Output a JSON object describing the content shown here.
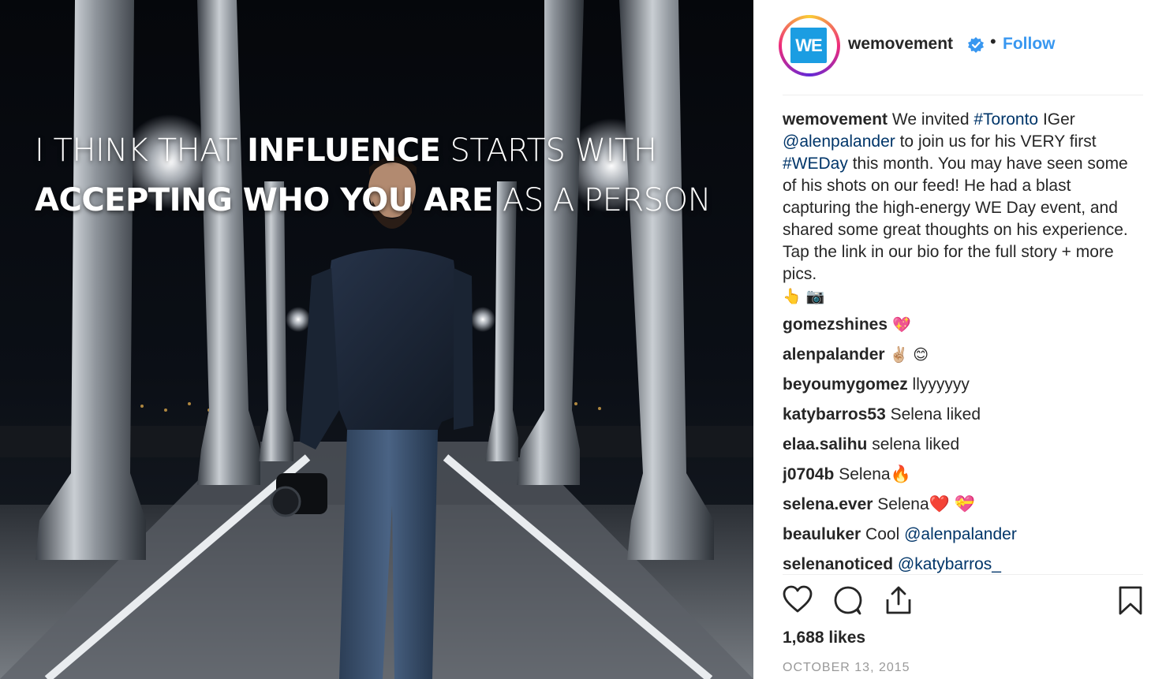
{
  "post": {
    "quote": {
      "line1_light_a": "I THINK THAT ",
      "line1_bold": "INFLUENCE",
      "line1_light_b": " STARTS WITH",
      "line2_bold": "ACCEPTING WHO YOU ARE",
      "line2_light": " AS A PERSON"
    }
  },
  "header": {
    "avatar_text": "WE",
    "username": "wemovement",
    "dot": "•",
    "follow_label": "Follow"
  },
  "caption": {
    "username": "wemovement",
    "t1": " We invited ",
    "tag_toronto": "#Toronto",
    "t2": " IGer ",
    "mention": "@alenpalander",
    "t3": " to join us for his VERY first ",
    "tag_weday": "#WEDay",
    "t4": " this month. You may have seen some of his shots on our feed! He had a blast capturing the high-energy WE Day event, and shared some great thoughts on his experience. Tap the link in our bio for the full story + more pics.",
    "emojis": "👆 📷"
  },
  "comments": [
    {
      "user": "gomezshines",
      "text": " 💖"
    },
    {
      "user": "alenpalander",
      "text": " ✌🏼 😊"
    },
    {
      "user": "beyoumygomez",
      "text": " llyyyyyy"
    },
    {
      "user": "katybarros53",
      "text": " Selena liked"
    },
    {
      "user": "elaa.salihu",
      "text": " selena liked"
    },
    {
      "user": "j0704b",
      "text": " Selena🔥"
    },
    {
      "user": "selena.ever",
      "text": " Selena❤️ 💝"
    },
    {
      "user": "beauluker",
      "text": " Cool ",
      "mention": "@alenpalander"
    },
    {
      "user": "selenanoticed",
      "text": " ",
      "mention": "@katybarros_"
    }
  ],
  "actions": {
    "icons": [
      "heart-icon",
      "comment-icon",
      "share-icon",
      "bookmark-icon"
    ]
  },
  "likes": "1,688 likes",
  "date": "OCTOBER 13, 2015",
  "colors": {
    "link": "#003569",
    "follow": "#3897f0",
    "brand": "#1b9de2",
    "verified": "#3897f0"
  }
}
